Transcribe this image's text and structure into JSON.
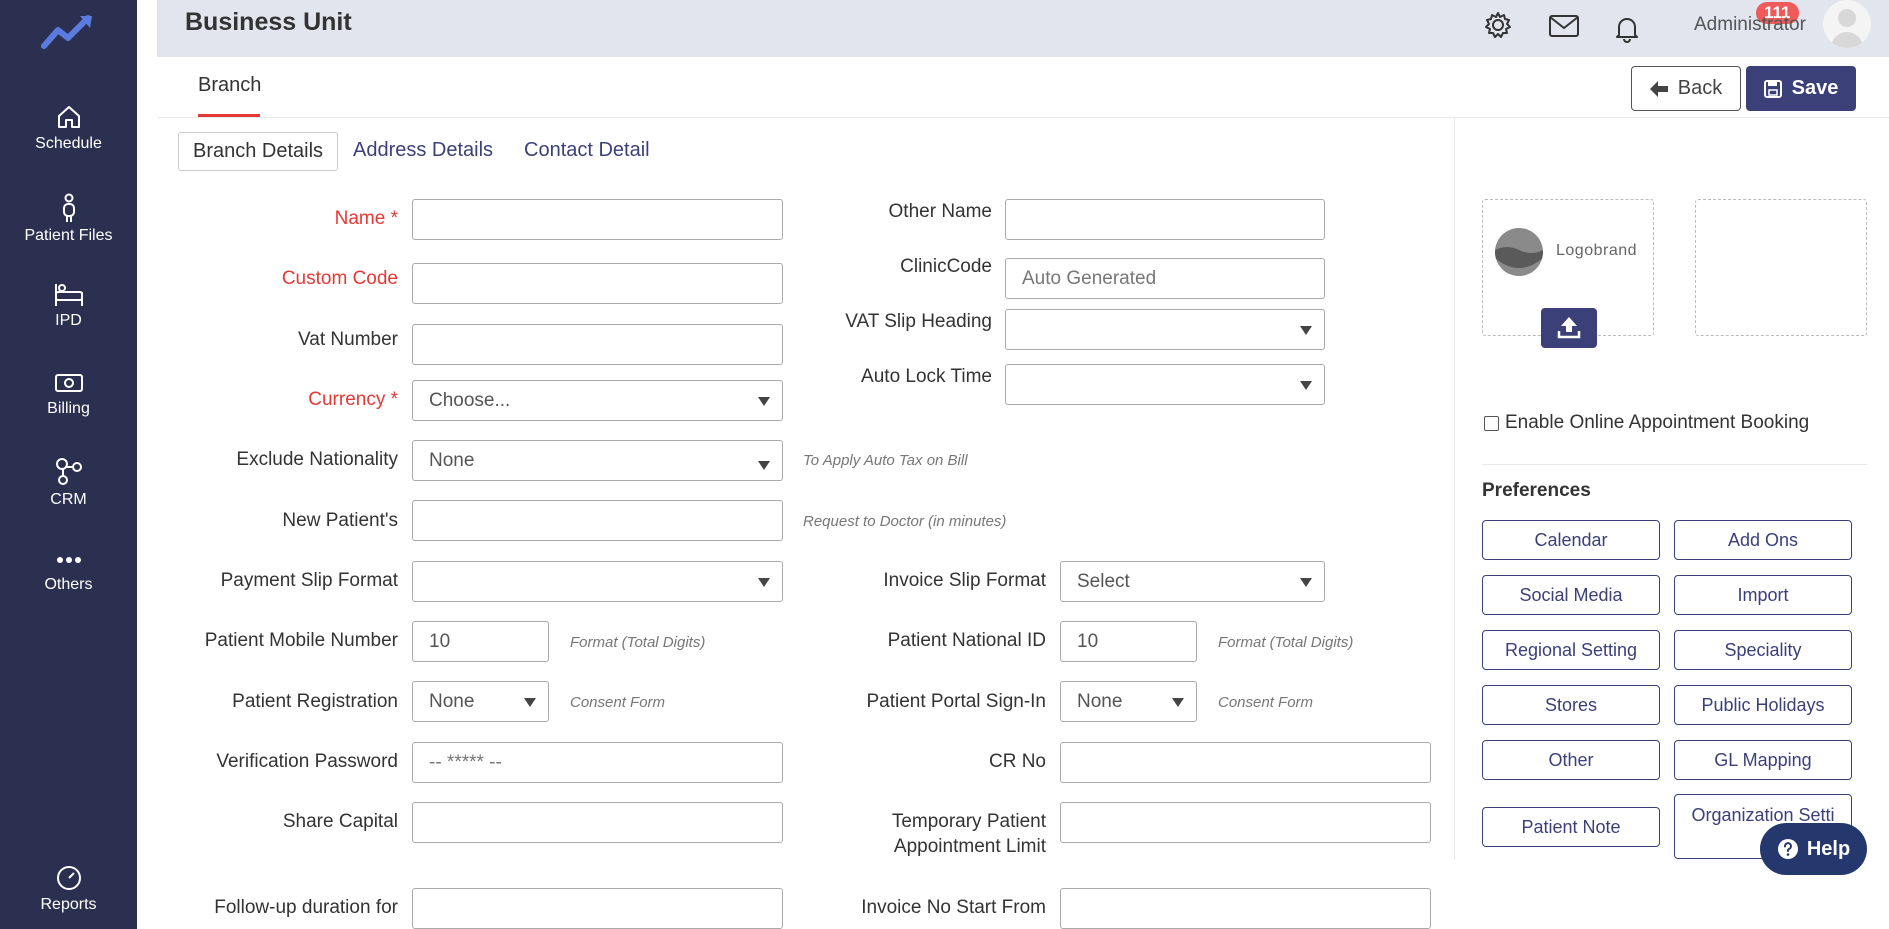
{
  "sidebar": {
    "items": [
      {
        "label": "Schedule",
        "icon": "home-icon"
      },
      {
        "label": "Patient Files",
        "icon": "person-icon"
      },
      {
        "label": "IPD",
        "icon": "bed-icon"
      },
      {
        "label": "Billing",
        "icon": "money-icon"
      },
      {
        "label": "CRM",
        "icon": "network-icon"
      },
      {
        "label": "Others",
        "icon": "dots-icon"
      },
      {
        "label": "Reports",
        "icon": "gauge-icon"
      }
    ]
  },
  "header": {
    "title": "Business Unit",
    "notification_count": "111",
    "user_name": "Administrator"
  },
  "top_tabs": {
    "branch": "Branch"
  },
  "actions": {
    "back": "Back",
    "save": "Save"
  },
  "sub_tabs": [
    "Branch Details",
    "Address Details",
    "Contact Detail"
  ],
  "form": {
    "name_label": "Name *",
    "custom_code_label": "Custom Code",
    "vat_number_label": "Vat Number",
    "currency_label": "Currency *",
    "currency_value": "Choose...",
    "exclude_nationality_label": "Exclude Nationality",
    "exclude_nationality_value": "None",
    "exclude_nationality_hint": "To Apply Auto Tax on Bill",
    "new_patient_label": "New Patient's",
    "new_patient_hint": "Request to Doctor (in minutes)",
    "payment_slip_label": "Payment Slip Format",
    "patient_mobile_label": "Patient Mobile Number",
    "patient_mobile_value": "10",
    "patient_mobile_hint": "Format (Total Digits)",
    "patient_registration_label": "Patient Registration",
    "patient_registration_value": "None",
    "patient_registration_hint": "Consent Form",
    "verification_password_label": "Verification Password",
    "verification_password_placeholder": "-- ***** --",
    "share_capital_label": "Share Capital",
    "followup_label": "Follow-up duration for",
    "other_name_label": "Other Name",
    "clinic_code_label": "ClinicCode",
    "clinic_code_placeholder": "Auto Generated",
    "vat_slip_label": "VAT Slip Heading",
    "auto_lock_label": "Auto Lock Time",
    "invoice_slip_label": "Invoice Slip Format",
    "invoice_slip_value": "Select",
    "patient_national_id_label": "Patient National ID",
    "patient_national_id_value": "10",
    "patient_national_id_hint": "Format (Total Digits)",
    "portal_signin_label": "Patient Portal Sign-In",
    "portal_signin_value": "None",
    "portal_signin_hint": "Consent Form",
    "cr_no_label": "CR No",
    "temp_patient_label_1": "Temporary Patient",
    "temp_patient_label_2": "Appointment Limit",
    "invoice_no_label": "Invoice No Start From"
  },
  "right_panel": {
    "logo_text": "Logobrand",
    "online_booking_label": "Enable Online Appointment Booking",
    "preferences_title": "Preferences",
    "preferences": [
      "Calendar",
      "Add Ons",
      "Social Media",
      "Import",
      "Regional Setting",
      "Speciality",
      "Stores",
      "Public Holidays",
      "Other",
      "GL Mapping",
      "Patient Note",
      "Organization Setti"
    ],
    "help_label": "Help"
  },
  "colors": {
    "sidebar": "#2b3050",
    "accent": "#3c4079",
    "required": "#e53935",
    "badge": "#f05a5a"
  }
}
